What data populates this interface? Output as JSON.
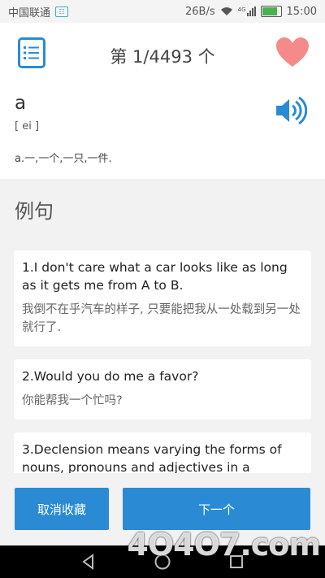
{
  "status": {
    "carrier": "中国联通",
    "sim_label": "☷",
    "speed": "26B/s",
    "signal_label": "4G",
    "time": "15:00"
  },
  "header": {
    "page_counter": "第 1/4493 个"
  },
  "word": {
    "text": "a",
    "phonetic": "[ ei ]",
    "meaning": "a.一,一个,一只,一件."
  },
  "examples": {
    "title": "例句",
    "items": [
      {
        "en": "1.I don't care what a car looks like as long as it gets me from A to B.",
        "zh": "我倒不在乎汽车的样子, 只要能把我从一处载到另一处就行了."
      },
      {
        "en": "2.Would you do me a favor?",
        "zh": "你能帮我一个忙吗?"
      },
      {
        "en": "3.Declension means varying the forms of nouns, pronouns and adjectives in a",
        "zh": ""
      }
    ]
  },
  "buttons": {
    "unfavorite": "取消收藏",
    "next": "下一个"
  },
  "watermark": "4O4O7.com",
  "colors": {
    "accent": "#2a8bd4",
    "heart": "#f58a8a"
  }
}
